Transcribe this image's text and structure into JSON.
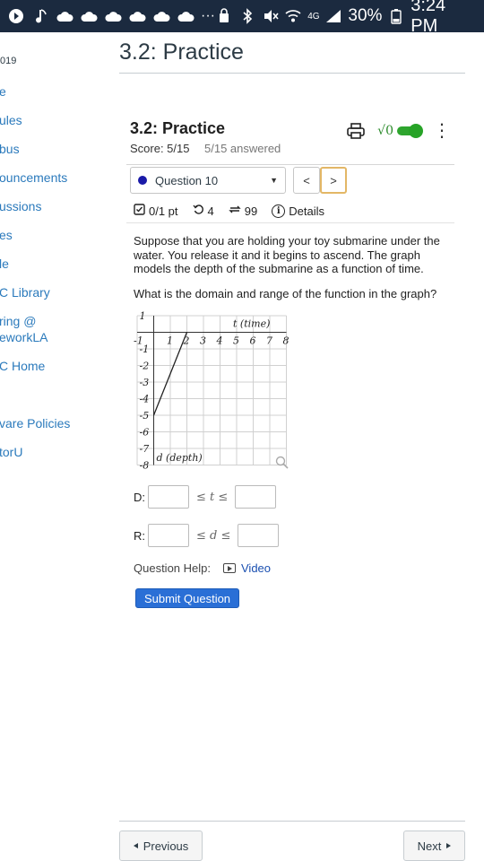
{
  "status_bar": {
    "battery": "30%",
    "time": "3:24 PM",
    "network": "4G",
    "left_icons": [
      "app-icon",
      "music-icon",
      "cloud-icon",
      "cloud-icon",
      "cloud-icon",
      "cloud-icon",
      "cloud-icon",
      "cloud-icon"
    ],
    "more": "···"
  },
  "left_nav": {
    "year": "019",
    "items": [
      "e",
      "ules",
      "bus",
      "ouncements",
      "ussions",
      "es",
      "le",
      "C Library",
      "ring @",
      "eworkLA",
      "C Home",
      "vare Policies",
      "torU"
    ]
  },
  "page": {
    "title": "3.2: Practice"
  },
  "assignment": {
    "title": "3.2: Practice",
    "score": "Score: 5/15",
    "answered": "5/15 answered",
    "sqrt_label": "√0"
  },
  "question": {
    "selector": "Question 10",
    "points": "0/1 pt",
    "retries": "4",
    "attempts": "99",
    "details": "Details",
    "prompt": "Suppose that you are holding your toy submarine under the water. You release it and it begins to ascend. The graph models the depth of the submarine as a function of time.",
    "ask": "What is the domain and range of the function in the graph?",
    "graph": {
      "x_label": "t (time)",
      "y_label": "d (depth)",
      "x_range": [
        -1,
        8
      ],
      "y_range": [
        -8,
        1
      ],
      "x_ticks": [
        "-1",
        "1",
        "2",
        "3",
        "4",
        "5",
        "6",
        "7",
        "8"
      ],
      "y_ticks": [
        "1",
        "-1",
        "-2",
        "-3",
        "-4",
        "-5",
        "-6",
        "-7",
        "-8"
      ],
      "segment": [
        [
          0,
          -5
        ],
        [
          2,
          0
        ]
      ]
    },
    "domain_label": "D:",
    "range_label": "R:",
    "domain_symbol": "≤ t ≤",
    "range_symbol": "≤ d ≤",
    "help_label": "Question Help:",
    "video_label": "Video",
    "submit_label": "Submit Question"
  },
  "footer": {
    "previous": "Previous",
    "next": "Next"
  }
}
